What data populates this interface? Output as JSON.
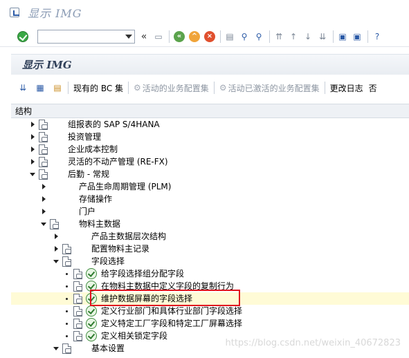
{
  "window": {
    "title": "显示 IMG"
  },
  "toolbar": {
    "command_field_value": ""
  },
  "header": {
    "title": "显示 IMG"
  },
  "app_toolbar": {
    "bc_sets": "现有的 BC 集",
    "active_biz_config_sets": "活动的业务配置集",
    "activated_biz_config_sets": "活动已激活的业务配置集",
    "change_log": "更改日志",
    "truncated": "否"
  },
  "tree": {
    "header": "结构",
    "rows": [
      {
        "level": 0,
        "toggle": "c",
        "icon": "doc",
        "label": "组报表的 SAP S/4HANA"
      },
      {
        "level": 0,
        "toggle": "c",
        "icon": "doc",
        "label": "投资管理"
      },
      {
        "level": 0,
        "toggle": "c",
        "icon": "doc",
        "label": "企业成本控制"
      },
      {
        "level": 0,
        "toggle": "c",
        "icon": "doc",
        "label": "灵活的不动产管理 (RE-FX)"
      },
      {
        "level": 0,
        "toggle": "e",
        "icon": "doc",
        "label": "后勤 - 常规"
      },
      {
        "level": 1,
        "toggle": "c",
        "icon": "none",
        "label": "产品生命周期管理 (PLM)"
      },
      {
        "level": 1,
        "toggle": "c",
        "icon": "none",
        "label": "存储操作"
      },
      {
        "level": 1,
        "toggle": "c",
        "icon": "none",
        "label": "门户"
      },
      {
        "level": 1,
        "toggle": "e",
        "icon": "doc",
        "label": "物料主数据"
      },
      {
        "level": 2,
        "toggle": "c",
        "icon": "none",
        "label": "产品主数据层次结构"
      },
      {
        "level": 2,
        "toggle": "c",
        "icon": "doc",
        "label": "配置物料主记录"
      },
      {
        "level": 2,
        "toggle": "e",
        "icon": "doc",
        "label": "字段选择"
      },
      {
        "level": 3,
        "toggle": "d",
        "icon": "doc-exec",
        "label": "给字段选择组分配字段"
      },
      {
        "level": 3,
        "toggle": "d",
        "icon": "doc-exec",
        "label": "在物料主数据中定义字段的复制行为"
      },
      {
        "level": 3,
        "toggle": "d",
        "icon": "doc-exec",
        "label": "维护数据屏幕的字段选择",
        "highlight": true
      },
      {
        "level": 3,
        "toggle": "d",
        "icon": "doc-exec",
        "label": "定义行业部门和具体行业部门字段选择"
      },
      {
        "level": 3,
        "toggle": "d",
        "icon": "doc-exec",
        "label": "定义特定工厂字段和特定工厂屏幕选择"
      },
      {
        "level": 3,
        "toggle": "d",
        "icon": "doc-exec",
        "label": "定义相关锁定字段"
      },
      {
        "level": 2,
        "toggle": "e",
        "icon": "doc",
        "label": "基本设置"
      }
    ]
  },
  "watermark": "https://blog.csdn.net/weixin_40672823"
}
